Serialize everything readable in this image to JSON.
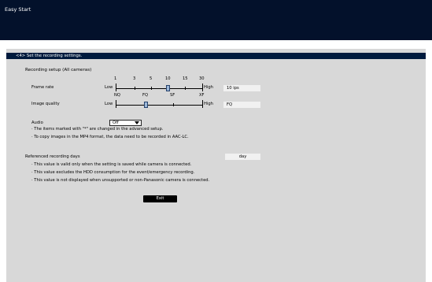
{
  "window": {
    "title": "Easy Start"
  },
  "step": {
    "label": "<4> Set the recording settings."
  },
  "recording_setup": {
    "title": "Recording setup (All cameras)",
    "frame_rate": {
      "label": "Frame rate",
      "scale_values": [
        "1",
        "3",
        "5",
        "10",
        "15",
        "30"
      ],
      "low_label": "Low",
      "high_label": "High",
      "value": "10 ips",
      "selected_index": 3
    },
    "image_quality": {
      "label": "Image quality",
      "scale_values": [
        "NQ",
        "FQ",
        "SF",
        "XF"
      ],
      "low_label": "Low",
      "high_label": "High",
      "value": "FQ",
      "selected_index": 1
    },
    "audio": {
      "label": "Audio",
      "value": "Off"
    },
    "notes": [
      "· The items marked with \"*\" are changed in the advanced setup.",
      "· To copy images in the MP4 format, the data need to be recorded in AAC-LC."
    ]
  },
  "referenced_days": {
    "label": "Referenced recording days",
    "value": "day",
    "notes": [
      "· This value is valid only when the setting is saved while camera is connected.",
      "· This value excludes the HDD consumption for the event/emergency recording.",
      "· This value is not displayed when unsupported or non-Panasonic camera is connected."
    ]
  },
  "actions": {
    "exit_label": "Exit"
  },
  "colors": {
    "titlebar": "#03112b",
    "panel": "#d8d8d8",
    "stepbar": "#001a3d",
    "knob": "#9db8d8"
  }
}
